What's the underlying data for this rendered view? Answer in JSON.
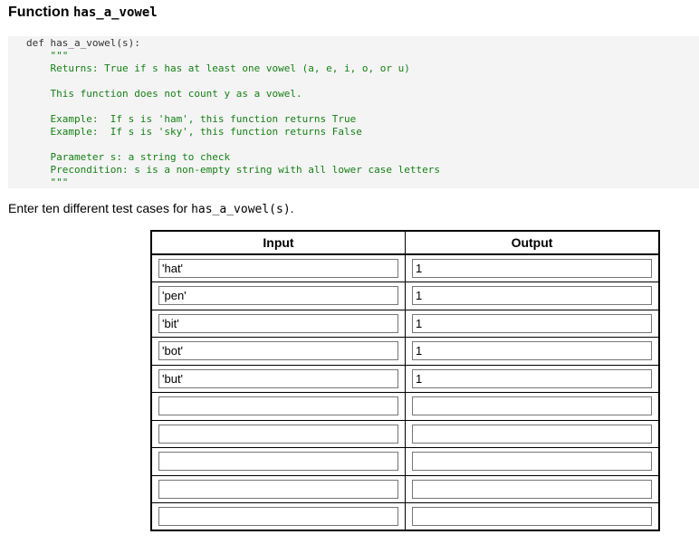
{
  "header": {
    "prefix": "Function ",
    "function_name": "has_a_vowel"
  },
  "code": {
    "lines": [
      {
        "text": "def has_a_vowel(s):",
        "doc": false
      },
      {
        "text": "    \"\"\"",
        "doc": true
      },
      {
        "text": "    Returns: True if s has at least one vowel (a, e, i, o, or u)",
        "doc": true
      },
      {
        "text": "",
        "doc": true
      },
      {
        "text": "    This function does not count y as a vowel.",
        "doc": true
      },
      {
        "text": "",
        "doc": true
      },
      {
        "text": "    Example:  If s is 'ham', this function returns True",
        "doc": true
      },
      {
        "text": "    Example:  If s is 'sky', this function returns False",
        "doc": true
      },
      {
        "text": "",
        "doc": true
      },
      {
        "text": "    Parameter s: a string to check",
        "doc": true
      },
      {
        "text": "    Precondition: s is a non-empty string with all lower case letters",
        "doc": true
      },
      {
        "text": "    \"\"\"",
        "doc": true
      }
    ]
  },
  "instruction": {
    "prefix": "Enter ten different test cases for ",
    "code": "has_a_vowel(s)",
    "suffix": "."
  },
  "table": {
    "headers": {
      "input": "Input",
      "output": "Output"
    },
    "rows": [
      {
        "input": "'hat'",
        "output": "1"
      },
      {
        "input": "'pen'",
        "output": "1"
      },
      {
        "input": "'bit'",
        "output": "1"
      },
      {
        "input": "'bot'",
        "output": "1"
      },
      {
        "input": "'but'",
        "output": "1"
      },
      {
        "input": "",
        "output": ""
      },
      {
        "input": "",
        "output": ""
      },
      {
        "input": "",
        "output": ""
      },
      {
        "input": "",
        "output": ""
      },
      {
        "input": "",
        "output": ""
      }
    ]
  }
}
